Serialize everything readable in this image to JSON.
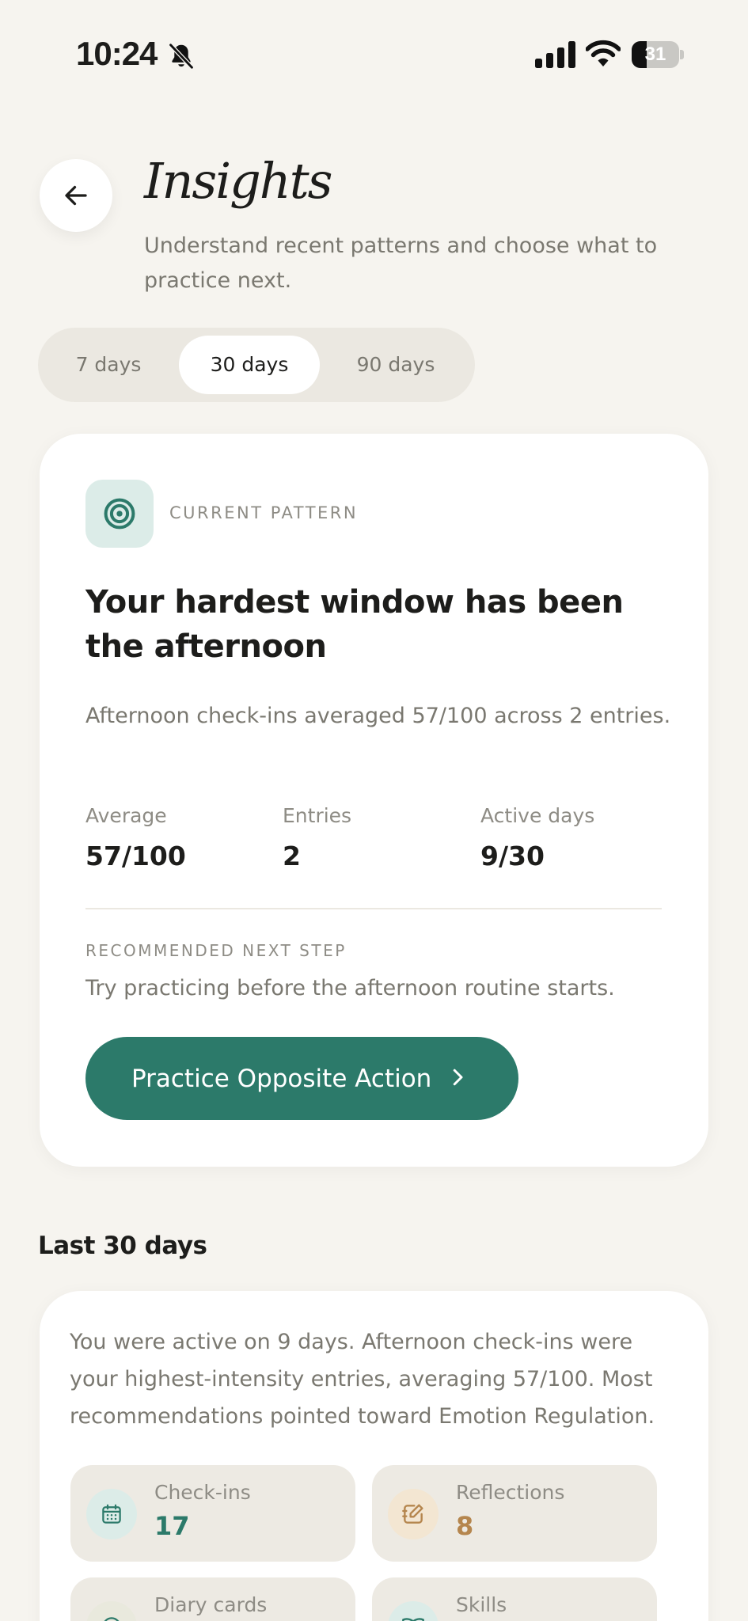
{
  "status_bar": {
    "time": "10:24",
    "battery_percent": 31,
    "battery_label": "31",
    "icons": [
      "bell-slash-icon",
      "signal-icon",
      "wifi-icon",
      "battery-icon"
    ]
  },
  "header": {
    "back_icon": "arrow-left-icon",
    "title": "Insights",
    "subtitle": "Understand recent patterns and choose what to practice next."
  },
  "range_tabs": {
    "items": [
      {
        "label": "7 days",
        "active": false
      },
      {
        "label": "30 days",
        "active": true
      },
      {
        "label": "90 days",
        "active": false
      }
    ]
  },
  "pattern_card": {
    "icon": "target-icon",
    "eyebrow": "CURRENT PATTERN",
    "headline": "Your hardest window has been the afternoon",
    "description": "Afternoon check-ins averaged 57/100 across 2 entries.",
    "stats": [
      {
        "label": "Average",
        "value": "57/100"
      },
      {
        "label": "Entries",
        "value": "2"
      },
      {
        "label": "Active days",
        "value": "9/30"
      }
    ],
    "recommendation_eyebrow": "RECOMMENDED NEXT STEP",
    "recommendation": "Try practicing before the afternoon routine starts.",
    "cta_label": "Practice Opposite Action",
    "cta_icon": "chevron-right-icon"
  },
  "summary": {
    "section_title": "Last 30 days",
    "text": "You were active on 9 days. Afternoon check-ins were your highest-intensity entries, averaging 57/100. Most recommendations pointed toward Emotion Regulation.",
    "tiles": [
      {
        "label": "Check-ins",
        "value": "17",
        "icon": "calendar-icon",
        "icon_bg": "#dcece8",
        "color": "#2c7a6a"
      },
      {
        "label": "Reflections",
        "value": "8",
        "icon": "notebook-pen-icon",
        "icon_bg": "#f3e6d2",
        "color": "#b5864e"
      },
      {
        "label": "Diary cards",
        "value": "",
        "icon": "circle-icon",
        "icon_bg": "#e9e9dd",
        "color": "#2c7a6a"
      },
      {
        "label": "Skills",
        "value": "",
        "icon": "book-open-icon",
        "icon_bg": "#dcece8",
        "color": "#2c7a6a"
      }
    ]
  },
  "colors": {
    "background": "#f6f4ef",
    "accent": "#2c7a6a",
    "accent_warm": "#b5864e",
    "muted_text": "#7a7870"
  }
}
